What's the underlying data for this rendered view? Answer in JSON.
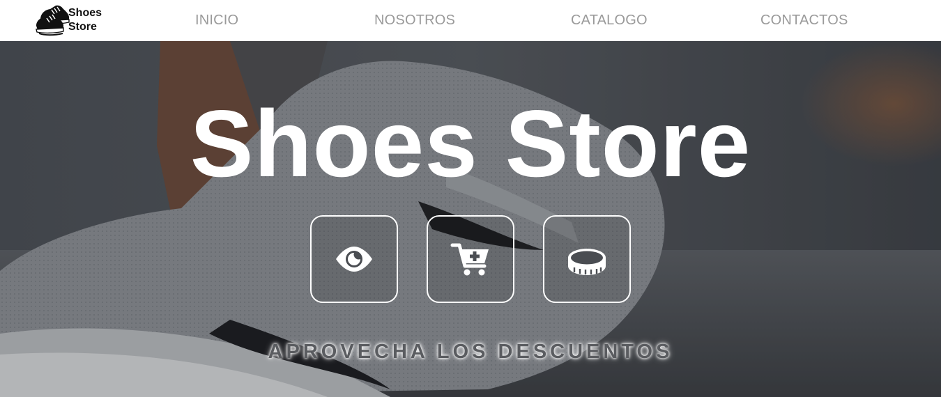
{
  "header": {
    "logo": {
      "line1": "Shoes",
      "line2": "Store",
      "icon": "shoes-icon"
    },
    "nav": [
      {
        "label": "INICIO"
      },
      {
        "label": "NOSOTROS"
      },
      {
        "label": "CATALOGO"
      },
      {
        "label": "CONTACTOS"
      }
    ]
  },
  "hero": {
    "title": "Shoes Store",
    "buttons": [
      {
        "icon": "eye-icon"
      },
      {
        "icon": "cart-plus-icon"
      },
      {
        "icon": "coin-icon"
      }
    ],
    "tagline": "APROVECHA LOS DESCUENTOS"
  },
  "colors": {
    "nav_text": "#9a9a9a",
    "hero_text": "#ffffff",
    "tagline_text": "#5a5c60"
  }
}
